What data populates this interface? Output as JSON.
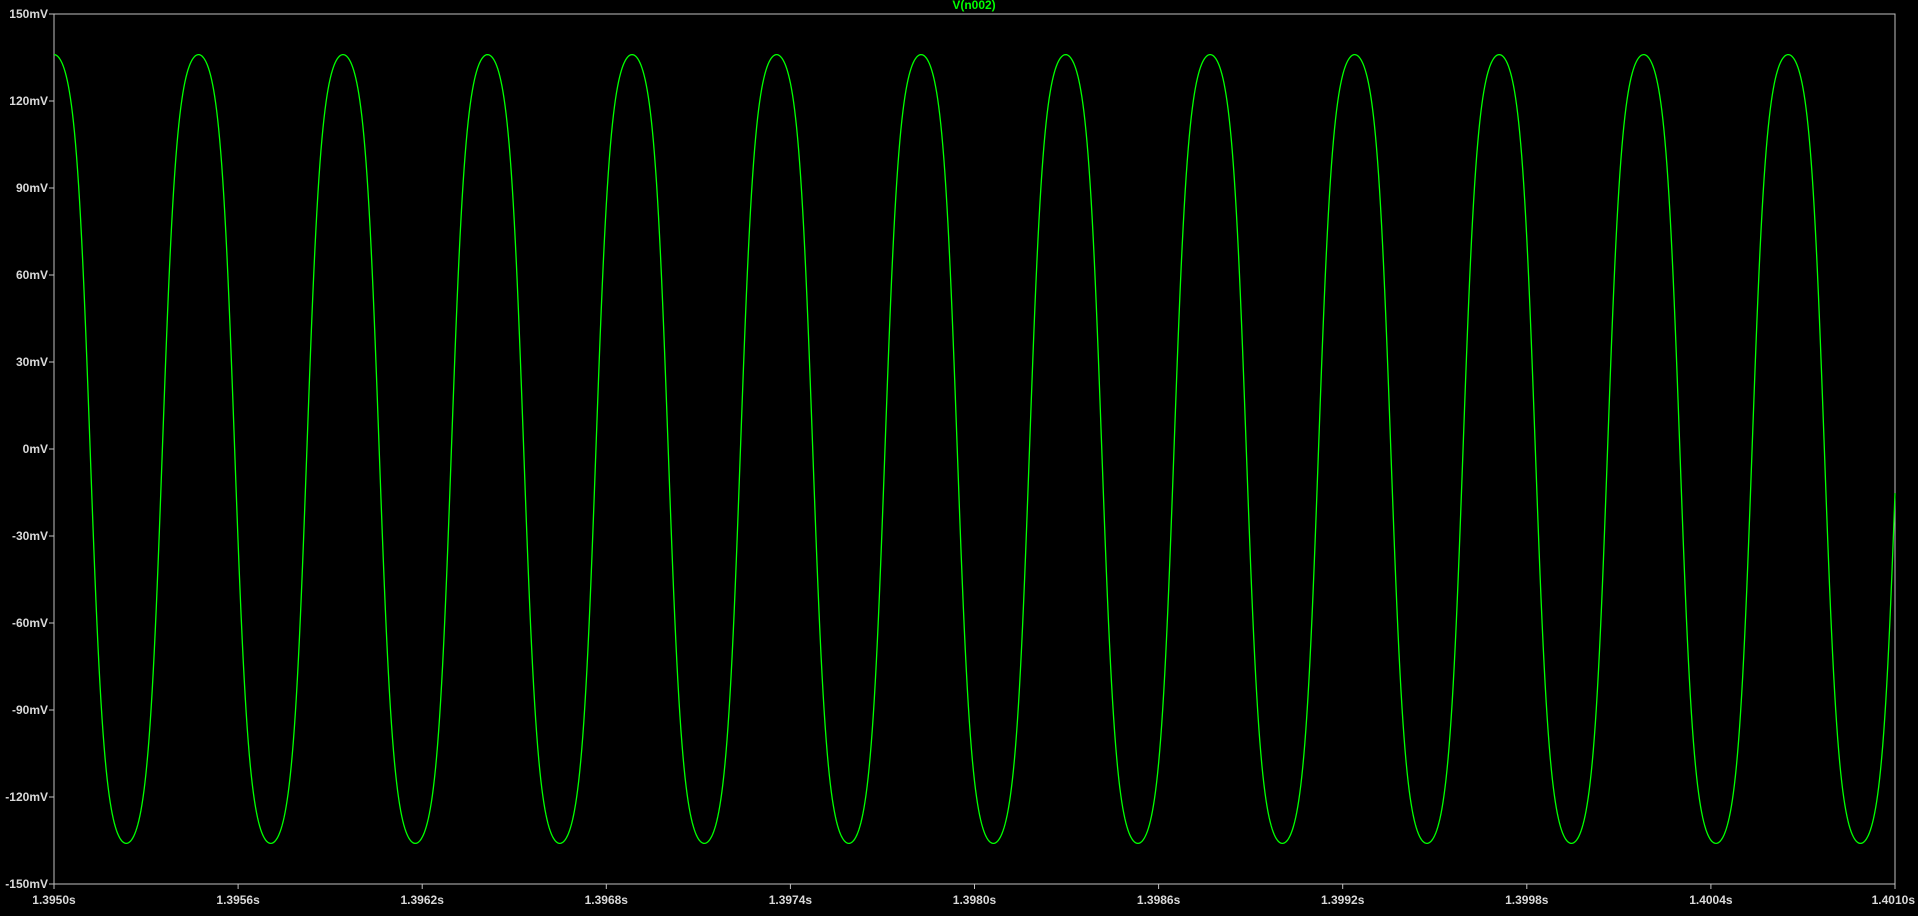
{
  "chart_data": {
    "type": "line",
    "title": "V(n002)",
    "xlabel": "",
    "ylabel": "",
    "xlim": [
      1.395,
      1.401
    ],
    "ylim": [
      -150,
      150
    ],
    "grid": false,
    "x_ticks": [
      "1.3950s",
      "1.3956s",
      "1.3962s",
      "1.3968s",
      "1.3974s",
      "1.3980s",
      "1.3986s",
      "1.3992s",
      "1.3998s",
      "1.4004s",
      "1.4010s"
    ],
    "x_tick_values": [
      1.395,
      1.3956,
      1.3962,
      1.3968,
      1.3974,
      1.398,
      1.3986,
      1.3992,
      1.3998,
      1.4004,
      1.401
    ],
    "y_ticks": [
      "150mV",
      "120mV",
      "90mV",
      "60mV",
      "30mV",
      "0mV",
      "-30mV",
      "-60mV",
      "-90mV",
      "-120mV",
      "-150mV"
    ],
    "y_tick_values": [
      150,
      120,
      90,
      60,
      30,
      0,
      -30,
      -60,
      -90,
      -120,
      -150
    ],
    "series": [
      {
        "name": "V(n002)",
        "color": "#00ff00",
        "amplitude_mv": 136,
        "period_s": 0.000471,
        "peak_time_s": 1.395,
        "xy": [
          [
            1.395,
            136
          ],
          [
            1.39505,
            130
          ],
          [
            1.3951,
            100
          ],
          [
            1.39515,
            20
          ],
          [
            1.3952,
            -80
          ],
          [
            1.39525,
            -125
          ],
          [
            1.3953,
            -134
          ],
          [
            1.39535,
            -136
          ],
          [
            1.3954,
            -134
          ],
          [
            1.39545,
            -120
          ],
          [
            1.3955,
            -40
          ],
          [
            1.39555,
            60
          ],
          [
            1.3956,
            120
          ],
          [
            1.39565,
            133
          ],
          [
            1.3957,
            136
          ],
          [
            1.39575,
            135
          ],
          [
            1.3958,
            125
          ],
          [
            1.39585,
            60
          ],
          [
            1.3959,
            -40
          ],
          [
            1.39595,
            -120
          ],
          [
            1.396,
            -133
          ],
          [
            1.39605,
            -136
          ],
          [
            1.3961,
            -133
          ],
          [
            1.39615,
            -110
          ]
        ]
      }
    ]
  }
}
